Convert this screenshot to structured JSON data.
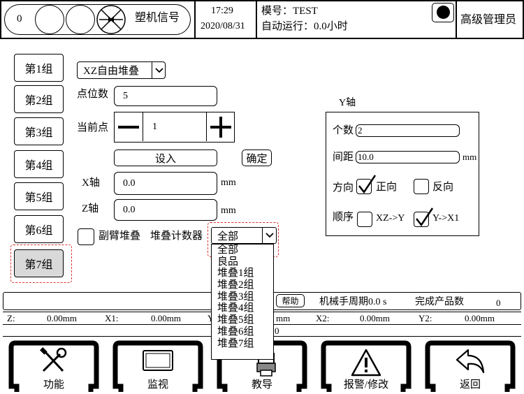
{
  "header": {
    "counter": "0",
    "machine_signal": "塑机信号",
    "time": "17:29",
    "date": "2020/08/31",
    "mold_label": "模号：TEST",
    "auto_run_label": "自动运行：0.0小时",
    "user_level": "高级管理员"
  },
  "groups": [
    "第1组",
    "第2组",
    "第3组",
    "第4组",
    "第5组",
    "第6组",
    "第7组"
  ],
  "selected_group": "第7组",
  "main": {
    "mode_value": "XZ自由堆叠",
    "points_label": "点位数",
    "points_value": "5",
    "current_point_label": "当前点",
    "current_point_value": "1",
    "minus_glyph": "—",
    "plus_glyph": "+",
    "set_in_button": "设入",
    "confirm_button": "确定",
    "x_axis_label": "X轴",
    "x_axis_value": "0.0",
    "x_unit": "mm",
    "z_axis_label": "Z轴",
    "z_axis_value": "0.0",
    "z_unit": "mm",
    "sub_arm_stack_label": "副臂堆叠",
    "stack_counter_label": "堆叠计数器",
    "stack_counter_value": "全部",
    "stack_counter_options": [
      "全部",
      "良品",
      "堆叠1组",
      "堆叠2组",
      "堆叠3组",
      "堆叠4组",
      "堆叠5组",
      "堆叠6组",
      "堆叠7组"
    ]
  },
  "y_axis": {
    "title": "Y轴",
    "count_label": "个数",
    "count_value": "2",
    "spacing_label": "间距",
    "spacing_value": "10.0",
    "spacing_unit": "mm",
    "direction_label": "方向",
    "forward_label": "正向",
    "forward_checked": true,
    "reverse_label": "反向",
    "reverse_checked": false,
    "order_label": "顺序",
    "order_xz_y_label": "XZ->Y",
    "order_xz_y_checked": false,
    "order_y_x1_label": "Y->X1",
    "order_y_x1_checked": true
  },
  "status": {
    "help_button": "帮助",
    "cycle_label": "机械手周期0.0 s",
    "products_label": "完成产品数",
    "products_value": "0",
    "z_label": "Z:",
    "z_value": "0.00mm",
    "x1_label": "X1:",
    "x1_value": "0.00mm",
    "y1_fragment": "Y",
    "mm_fragment": "mm",
    "x2_label": "X2:",
    "x2_value": "0.00mm",
    "y2_label": "Y2:",
    "y2_value": "0.00mm",
    "zero_fragment": "0"
  },
  "footer": {
    "function": "功能",
    "monitor": "监视",
    "teach": "教导",
    "alarm": "报警/修改",
    "back": "返回"
  }
}
